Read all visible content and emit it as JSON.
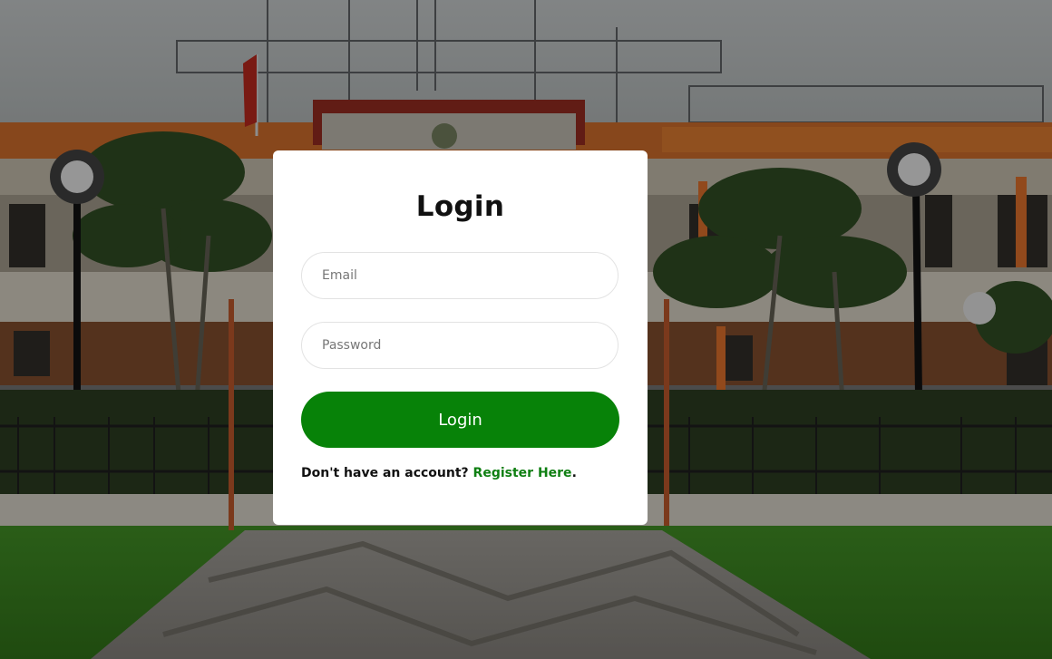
{
  "login": {
    "title": "Login",
    "email_placeholder": "Email",
    "password_placeholder": "Password",
    "submit_label": "Login",
    "register_prompt": "Don't have an account? ",
    "register_link": "Register Here",
    "register_suffix": "."
  },
  "colors": {
    "accent": "#078208",
    "link": "#0f7f12",
    "card": "#ffffff"
  }
}
